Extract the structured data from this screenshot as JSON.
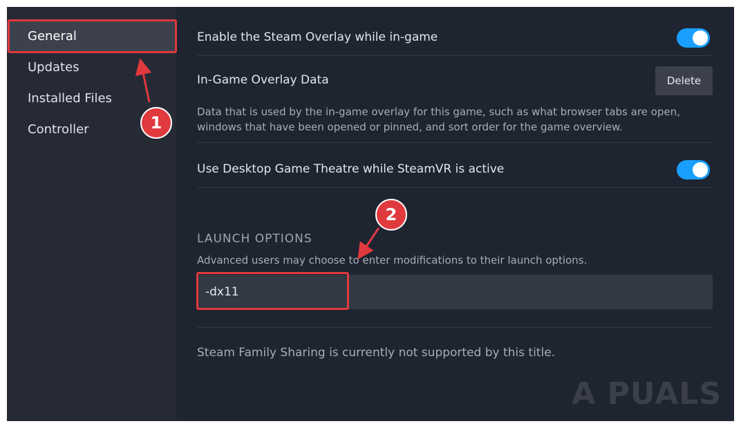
{
  "sidebar": {
    "items": [
      {
        "label": "General"
      },
      {
        "label": "Updates"
      },
      {
        "label": "Installed Files"
      },
      {
        "label": "Controller"
      }
    ]
  },
  "main": {
    "overlay_toggle_label": "Enable the Steam Overlay while in-game",
    "overlay_toggle_on": true,
    "overlay_data_label": "In-Game Overlay Data",
    "delete_button": "Delete",
    "overlay_data_desc": "Data that is used by the in-game overlay for this game, such as what browser tabs are open, windows that have been opened or pinned, and sort order for the game overview.",
    "theatre_toggle_label": "Use Desktop Game Theatre while SteamVR is active",
    "theatre_toggle_on": true,
    "launch_options": {
      "title": "LAUNCH OPTIONS",
      "desc": "Advanced users may choose to enter modifications to their launch options.",
      "value": "-dx11"
    },
    "family_sharing": "Steam Family Sharing is currently not supported by this title."
  },
  "annotations": {
    "callout_1": "1",
    "callout_2": "2",
    "color": "#e0393e"
  },
  "watermark": "A PUALS",
  "colors": {
    "toggle_on": "#1a9fff",
    "background": "#1e2430",
    "sidebar": "#252a35"
  }
}
